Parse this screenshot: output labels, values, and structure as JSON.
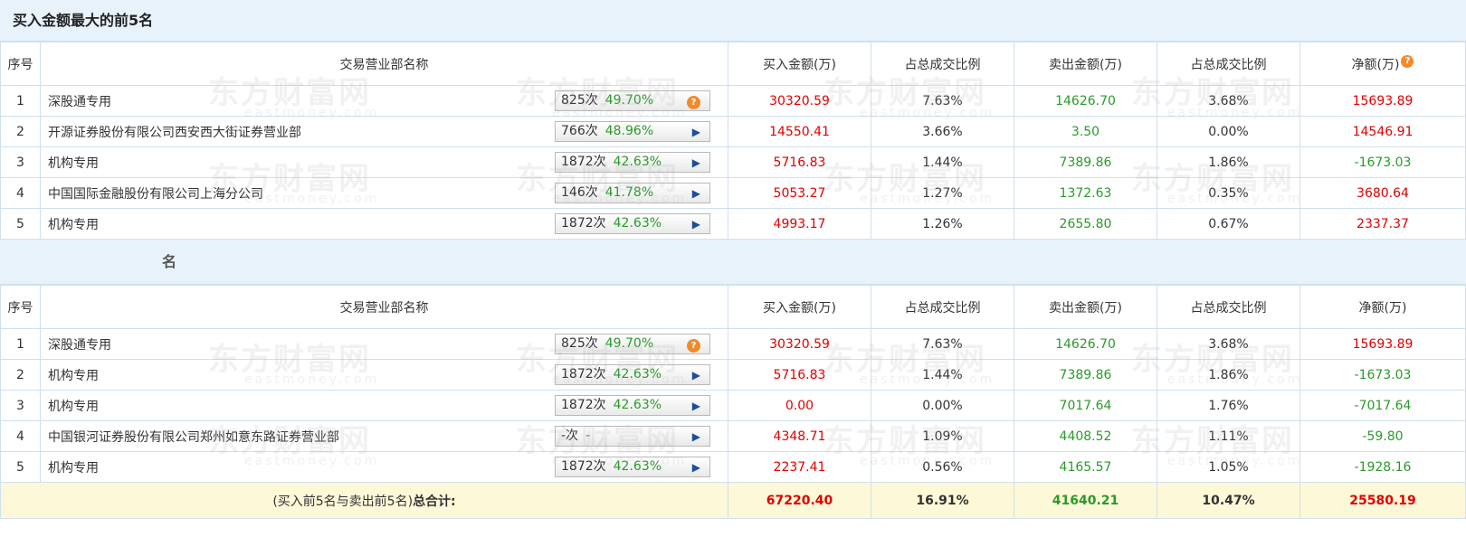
{
  "section1": {
    "title": "买入金额最大的前5名",
    "headers": {
      "idx": "序号",
      "name": "交易营业部名称",
      "buy": "买入金额(万)",
      "buy_pct": "占总成交比例",
      "sell": "卖出金额(万)",
      "sell_pct": "占总成交比例",
      "net": "净额(万)"
    },
    "rows": [
      {
        "idx": "1",
        "name": "深股通专用",
        "count": "825次",
        "pct": "49.70%",
        "icon": "question-icon",
        "buy": "30320.59",
        "buy_pct": "7.63%",
        "sell": "14626.70",
        "sell_pct": "3.68%",
        "net": "15693.89"
      },
      {
        "idx": "2",
        "name": "开源证券股份有限公司西安西大街证券营业部",
        "count": "766次",
        "pct": "48.96%",
        "icon": "arrow-right-icon",
        "buy": "14550.41",
        "buy_pct": "3.66%",
        "sell": "3.50",
        "sell_pct": "0.00%",
        "net": "14546.91"
      },
      {
        "idx": "3",
        "name": "机构专用",
        "count": "1872次",
        "pct": "42.63%",
        "icon": "arrow-right-icon",
        "buy": "5716.83",
        "buy_pct": "1.44%",
        "sell": "7389.86",
        "sell_pct": "1.86%",
        "net": "-1673.03"
      },
      {
        "idx": "4",
        "name": "中国国际金融股份有限公司上海分公司",
        "count": "146次",
        "pct": "41.78%",
        "icon": "arrow-right-icon",
        "buy": "5053.27",
        "buy_pct": "1.27%",
        "sell": "1372.63",
        "sell_pct": "0.35%",
        "net": "3680.64"
      },
      {
        "idx": "5",
        "name": "机构专用",
        "count": "1872次",
        "pct": "42.63%",
        "icon": "arrow-right-icon",
        "buy": "4993.17",
        "buy_pct": "1.26%",
        "sell": "2655.80",
        "sell_pct": "0.67%",
        "net": "2337.37"
      }
    ]
  },
  "section2": {
    "title": "名",
    "headers": {
      "idx": "序号",
      "name": "交易营业部名称",
      "buy": "买入金额(万)",
      "buy_pct": "占总成交比例",
      "sell": "卖出金额(万)",
      "sell_pct": "占总成交比例",
      "net": "净额(万)"
    },
    "rows": [
      {
        "idx": "1",
        "name": "深股通专用",
        "count": "825次",
        "pct": "49.70%",
        "icon": "question-icon",
        "buy": "30320.59",
        "buy_pct": "7.63%",
        "sell": "14626.70",
        "sell_pct": "3.68%",
        "net": "15693.89"
      },
      {
        "idx": "2",
        "name": "机构专用",
        "count": "1872次",
        "pct": "42.63%",
        "icon": "arrow-right-icon",
        "buy": "5716.83",
        "buy_pct": "1.44%",
        "sell": "7389.86",
        "sell_pct": "1.86%",
        "net": "-1673.03"
      },
      {
        "idx": "3",
        "name": "机构专用",
        "count": "1872次",
        "pct": "42.63%",
        "icon": "arrow-right-icon",
        "buy": "0.00",
        "buy_pct": "0.00%",
        "sell": "7017.64",
        "sell_pct": "1.76%",
        "net": "-7017.64"
      },
      {
        "idx": "4",
        "name": "中国银河证券股份有限公司郑州如意东路证券营业部",
        "count": "-次",
        "pct": "-",
        "icon": "arrow-right-icon",
        "buy": "4348.71",
        "buy_pct": "1.09%",
        "sell": "4408.52",
        "sell_pct": "1.11%",
        "net": "-59.80"
      },
      {
        "idx": "5",
        "name": "机构专用",
        "count": "1872次",
        "pct": "42.63%",
        "icon": "arrow-right-icon",
        "buy": "2237.41",
        "buy_pct": "0.56%",
        "sell": "4165.57",
        "sell_pct": "1.05%",
        "net": "-1928.16"
      }
    ],
    "total": {
      "label_prefix": "(买入前5名与卖出前5名)",
      "label_bold": "总合计:",
      "buy": "67220.40",
      "buy_pct": "16.91%",
      "sell": "41640.21",
      "sell_pct": "10.47%",
      "net": "25580.19"
    }
  },
  "watermark": {
    "brand": "东方财富网",
    "domain": "eastmoney.com"
  },
  "colors": {
    "positive": "#e00000",
    "negative": "#2a9a2a",
    "header_bg": "#e8f2fb",
    "total_bg": "#fdf8d8",
    "accent_icon": "#f08a2c"
  }
}
